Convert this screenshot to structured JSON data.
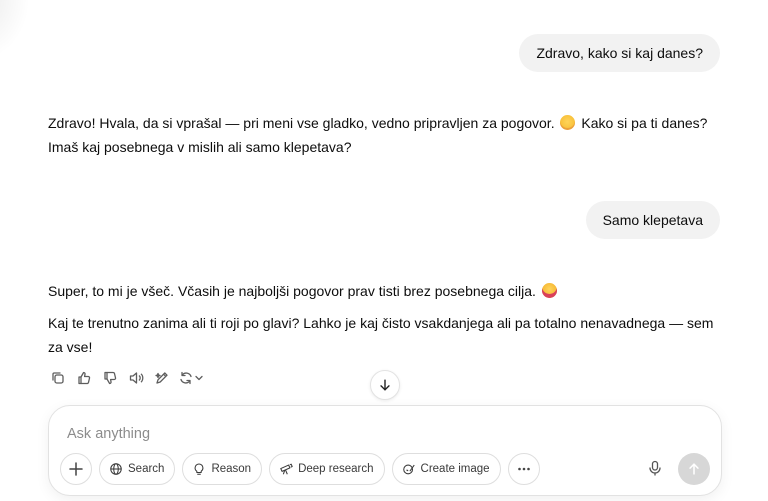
{
  "messages": [
    {
      "role": "user",
      "text": "Zdravo, kako si kaj danes?"
    },
    {
      "role": "assistant",
      "paragraphs": [
        {
          "before": "Zdravo! Hvala, da si vprašal — pri meni vse gladko, vedno pripravljen za pogovor.",
          "after": "Kako si pa ti danes? Imaš kaj posebnega v mislih ali samo klepetava?"
        }
      ]
    },
    {
      "role": "user",
      "text": "Samo klepetava"
    },
    {
      "role": "assistant",
      "paragraphs": [
        {
          "before": "Super, to mi je všeč. Včasih je najboljši pogovor prav tisti brez posebnega cilja."
        },
        {
          "before": "Kaj te trenutno zanima ali ti roji po glavi? Lahko je kaj čisto vsakdanjega ali pa totalno nenavadnega — sem za vse!"
        }
      ]
    }
  ],
  "emojis": [
    "smiling-face-emoji",
    "grinning-tongue-emoji"
  ],
  "message_actions": [
    "copy-icon",
    "thumbs-up-icon",
    "thumbs-down-icon",
    "read-aloud-icon",
    "edit-icon",
    "regenerate-icon"
  ],
  "composer": {
    "placeholder": "Ask anything",
    "tools": {
      "search": "Search",
      "reason": "Reason",
      "deep_research": "Deep research",
      "create_image": "Create image"
    }
  },
  "colors": {
    "bubble": "#f2f2f2",
    "text": "#0d0d0d",
    "send_disabled": "#d7d7d7"
  }
}
